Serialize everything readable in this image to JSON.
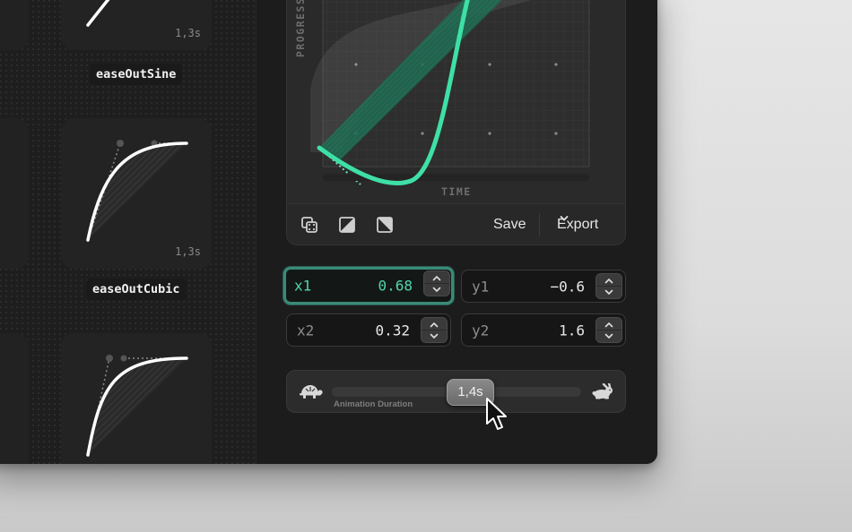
{
  "presets": [
    {
      "name": "easeOutSine",
      "duration": "1,3s"
    },
    {
      "name": "easeOutCubic",
      "duration": "1,3s"
    },
    {
      "name": "",
      "duration": ""
    }
  ],
  "graph": {
    "y_axis_label": "PROGRESSION",
    "x_axis_label": "TIME",
    "curve_color": "#3ee0a6"
  },
  "toolbar": {
    "random_icon": "dice-icon",
    "linear_icon": "linear-curve-icon",
    "reverse_icon": "reverse-curve-icon",
    "save_label": "Save",
    "export_label": "Export"
  },
  "bezier": {
    "x1": {
      "label": "x1",
      "value": "0.68"
    },
    "y1": {
      "label": "y1",
      "value": "−0.6"
    },
    "x2": {
      "label": "x2",
      "value": "0.32"
    },
    "y2": {
      "label": "y2",
      "value": "1.6"
    }
  },
  "duration": {
    "value": "1,4s",
    "caption": "Animation Duration",
    "fraction": 0.5,
    "slow_icon": "turtle-icon",
    "fast_icon": "rabbit-icon"
  },
  "colors": {
    "accent": "#3ee0a6",
    "accent_text": "#52d6ad",
    "window_bg": "#1c1c1c"
  }
}
